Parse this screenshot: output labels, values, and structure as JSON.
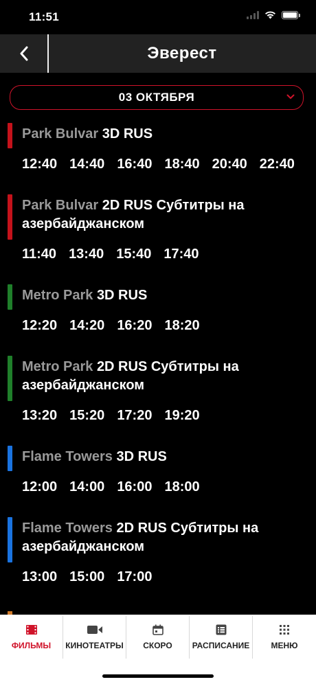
{
  "status": {
    "time": "11:51"
  },
  "header": {
    "title": "Эверест"
  },
  "date_select": {
    "value": "03 ОКТЯБРЯ"
  },
  "colors": {
    "accent": "#d0132a",
    "park_bulvar": "#c4121b",
    "metro_park": "#1f7f2a",
    "flame_towers": "#1a73e0",
    "next_venue": "#d07a2a"
  },
  "sessions": [
    {
      "venue": "Park Bulvar",
      "format": "3D RUS",
      "times": [
        "12:40",
        "14:40",
        "16:40",
        "18:40",
        "20:40",
        "22:40"
      ]
    },
    {
      "venue": "Park Bulvar",
      "format": "2D RUS Субтитры на азербайджанском",
      "times": [
        "11:40",
        "13:40",
        "15:40",
        "17:40"
      ]
    },
    {
      "venue": "Metro Park",
      "format": "3D RUS",
      "times": [
        "12:20",
        "14:20",
        "16:20",
        "18:20"
      ]
    },
    {
      "venue": "Metro Park",
      "format": "2D RUS Субтитры на азербайджанском",
      "times": [
        "13:20",
        "15:20",
        "17:20",
        "19:20"
      ]
    },
    {
      "venue": "Flame Towers",
      "format": "3D RUS",
      "times": [
        "12:00",
        "14:00",
        "16:00",
        "18:00"
      ]
    },
    {
      "venue": "Flame Towers",
      "format": "2D RUS Субтитры на азербайджанском",
      "times": [
        "13:00",
        "15:00",
        "17:00"
      ]
    }
  ],
  "tabbar": {
    "films": "ФИЛЬМЫ",
    "cinemas": "КИНОТЕАТРЫ",
    "soon": "СКОРО",
    "schedule": "РАСПИСАНИЕ",
    "menu": "МЕНЮ"
  },
  "icons": {
    "back": "chevron-left-icon",
    "dropdown": "chevron-down-icon",
    "films": "film-icon",
    "cinemas": "video-camera-icon",
    "soon": "calendar-icon",
    "schedule": "list-icon",
    "menu": "grid-dots-icon"
  }
}
